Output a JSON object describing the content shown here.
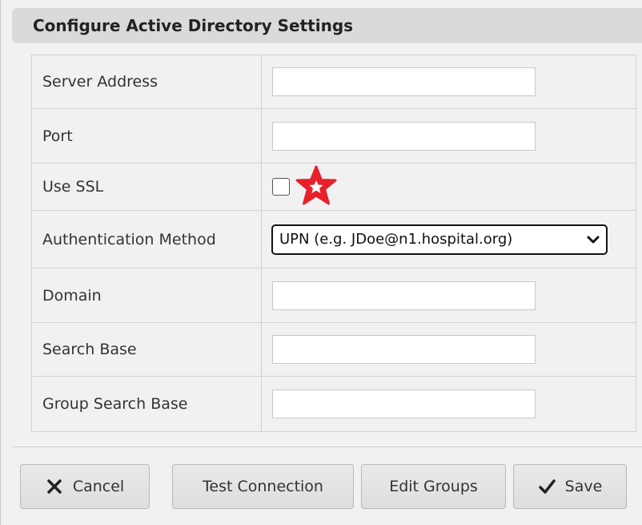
{
  "dialog": {
    "title": "Configure Active Directory Settings"
  },
  "form": {
    "server_address": {
      "label": "Server Address",
      "value": ""
    },
    "port": {
      "label": "Port",
      "value": ""
    },
    "use_ssl": {
      "label": "Use SSL",
      "checked": false
    },
    "auth_method": {
      "label": "Authentication Method",
      "selected": "UPN (e.g. JDoe@n1.hospital.org)"
    },
    "domain": {
      "label": "Domain",
      "value": ""
    },
    "search_base": {
      "label": "Search Base",
      "value": ""
    },
    "group_search_base": {
      "label": "Group Search Base",
      "value": ""
    }
  },
  "annotation": {
    "icon": "star-icon",
    "color": "#e8202a"
  },
  "buttons": {
    "cancel": {
      "label": "Cancel",
      "icon": "close-icon"
    },
    "test_connection": {
      "label": "Test Connection"
    },
    "edit_groups": {
      "label": "Edit Groups"
    },
    "save": {
      "label": "Save",
      "icon": "checkmark-icon"
    }
  },
  "colors": {
    "dialog_bg": "#f1f1f1",
    "titlebar_bg": "#dadada",
    "border": "#d2d2d2"
  }
}
